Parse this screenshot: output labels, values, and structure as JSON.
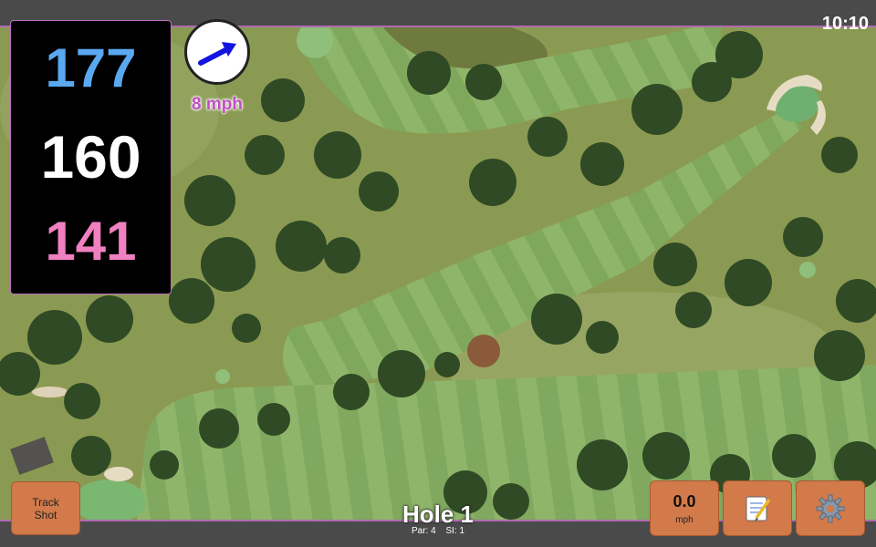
{
  "status": {
    "time": "10:10"
  },
  "distances": {
    "back": "177",
    "middle": "160",
    "front": "141"
  },
  "wind": {
    "speed": "8 mph",
    "direction_icon": "wind-arrow-icon"
  },
  "track_button": {
    "line1": "Track",
    "line2": "Shot"
  },
  "speed_button": {
    "value": "0.0",
    "unit": "mph"
  },
  "hole": {
    "title": "Hole 1",
    "par": "Par: 4",
    "si": "SI: 1"
  },
  "icons": {
    "notes": "notepad-icon",
    "settings": "gear-icon"
  },
  "colors": {
    "back_distance": "#5aa8f0",
    "middle_distance": "#ffffff",
    "front_distance": "#f080c0",
    "wind_text": "#c24ec4",
    "button": "#d27a4a",
    "accent_border": "#b06bb0"
  }
}
